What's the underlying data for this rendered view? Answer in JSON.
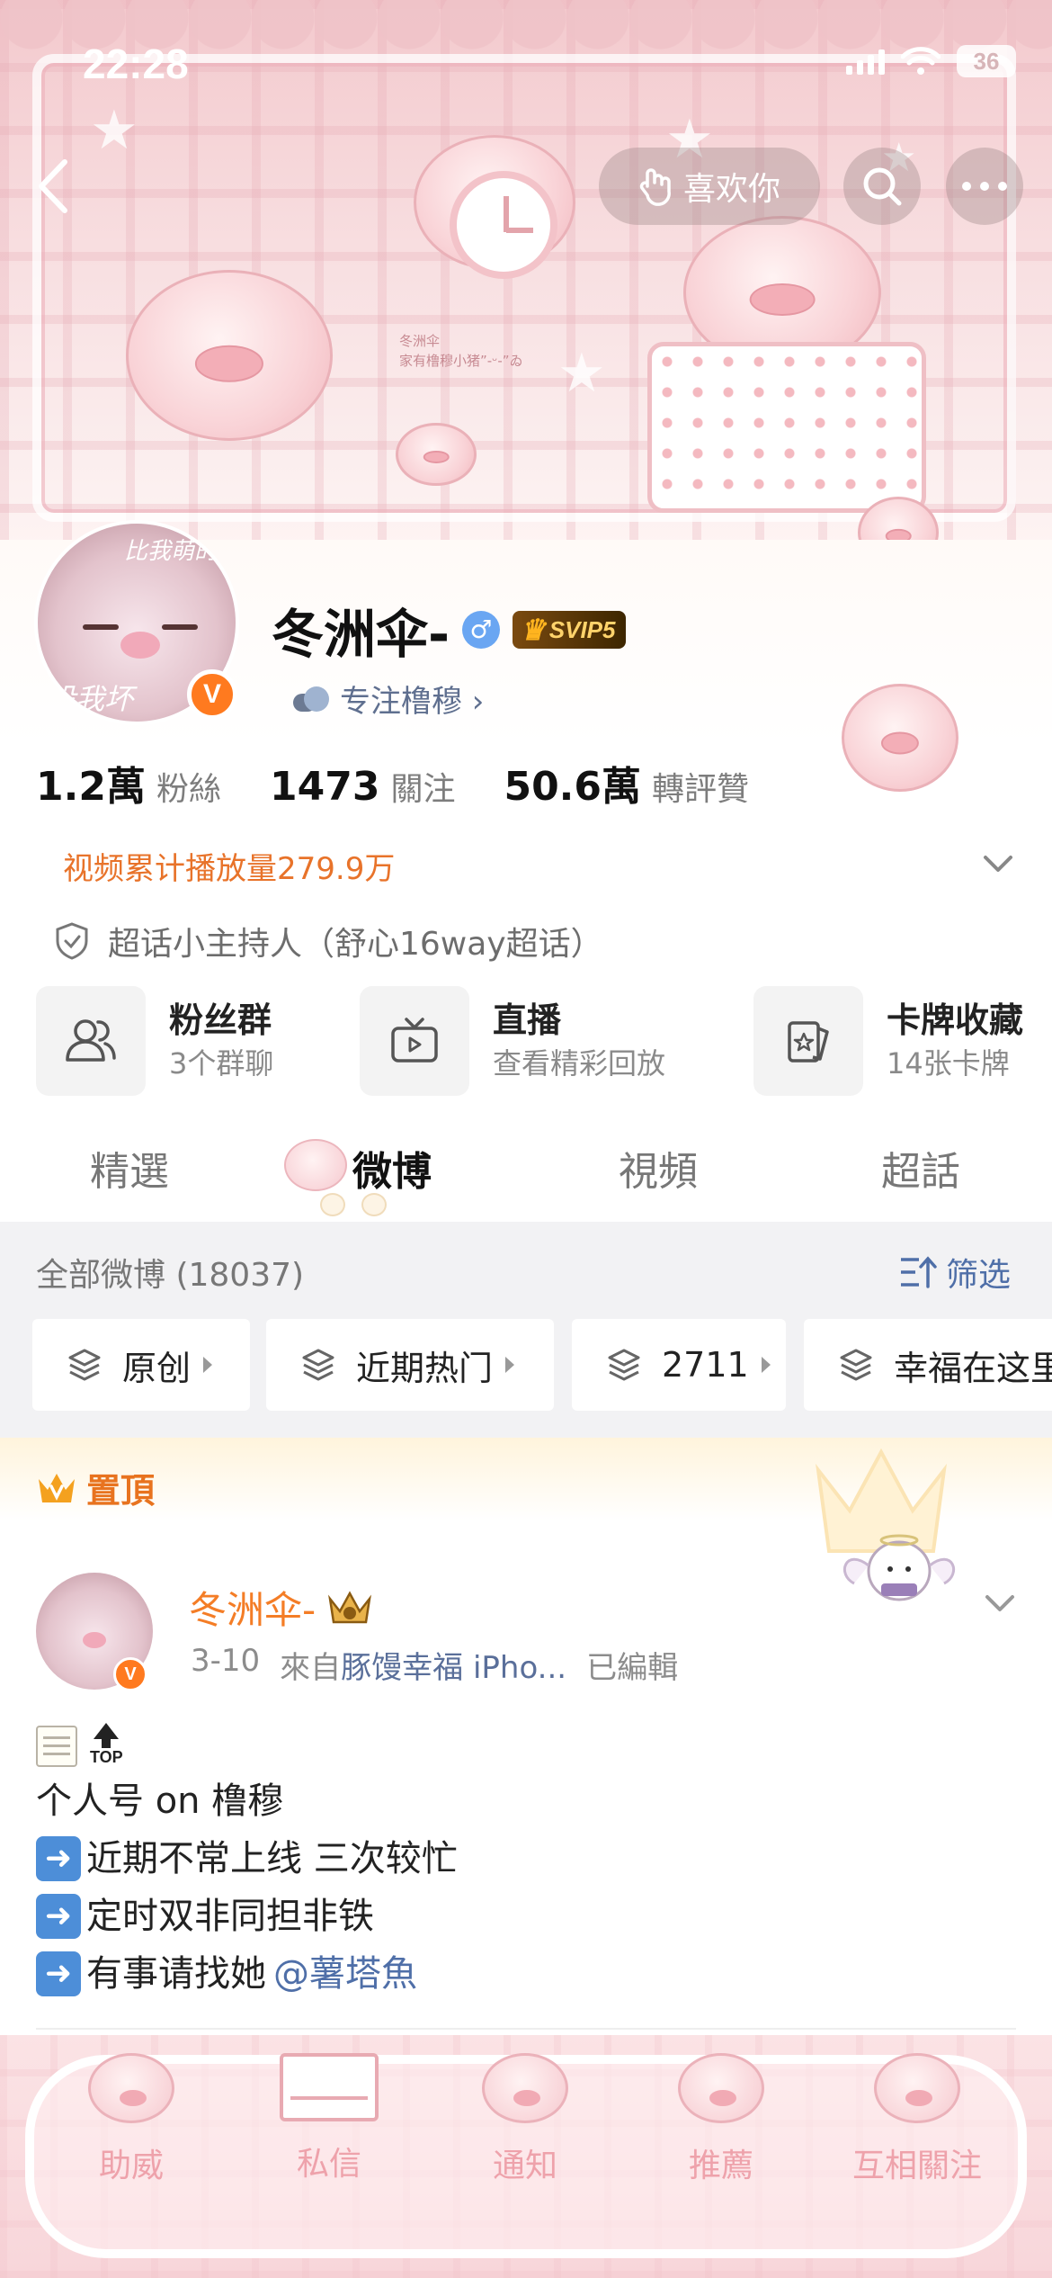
{
  "status_bar": {
    "time": "22:28",
    "battery": "36"
  },
  "header": {
    "like_label": "喜欢你"
  },
  "banner": {
    "caption_line1": "冬洲伞",
    "caption_line2": "家有橹穆小猪”-ᵕ-”ゐ"
  },
  "profile": {
    "avatar_text_top": "比我萌的",
    "avatar_text_bottom": "没我坏",
    "verified_mark": "V",
    "name": "冬洲伞-",
    "gender_symbol": "♂",
    "vip_badge": "SVIP5",
    "focus_label": "专注橹穆 ›",
    "stats": [
      {
        "num": "1.2萬",
        "label": "粉絲"
      },
      {
        "num": "1473",
        "label": "關注"
      },
      {
        "num": "50.6萬",
        "label": "轉評贊"
      }
    ],
    "video_plays": "视频累计播放量279.9万",
    "host_label": "超话小主持人（舒心16way超话）"
  },
  "features": [
    {
      "title": "粉丝群",
      "sub": "3个群聊",
      "icon": "users-icon"
    },
    {
      "title": "直播",
      "sub": "查看精彩回放",
      "icon": "tv-icon"
    },
    {
      "title": "卡牌收藏",
      "sub": "14张卡牌",
      "icon": "card-icon"
    }
  ],
  "tabs": [
    {
      "label": "精選",
      "active": false
    },
    {
      "label": "微博",
      "active": true
    },
    {
      "label": "視頻",
      "active": false
    },
    {
      "label": "超話",
      "active": false
    }
  ],
  "feed": {
    "count_label": "全部微博 (18037)",
    "filter_label": "筛选",
    "chips": [
      "原创",
      "近期热门",
      "2711",
      "幸福在这里"
    ]
  },
  "pinned": {
    "label": "置頂",
    "author": "冬洲伞-",
    "date": "3-10",
    "source_prefix": "來自",
    "source": "豚馒幸福 iPho...",
    "edited": "已編輯",
    "top_tag": "TOP",
    "lines": [
      "个人号 on 橹穆",
      "近期不常上线 三次较忙",
      "定时双非同担非铁",
      "有事请找她"
    ],
    "mention": "@薯塔魚"
  },
  "bottom_nav": [
    "助威",
    "私信",
    "通知",
    "推薦",
    "互相關注"
  ],
  "colors": {
    "accent_orange": "#f47d26",
    "link_blue": "#4f6fa8",
    "pink": "#eea2ab"
  }
}
